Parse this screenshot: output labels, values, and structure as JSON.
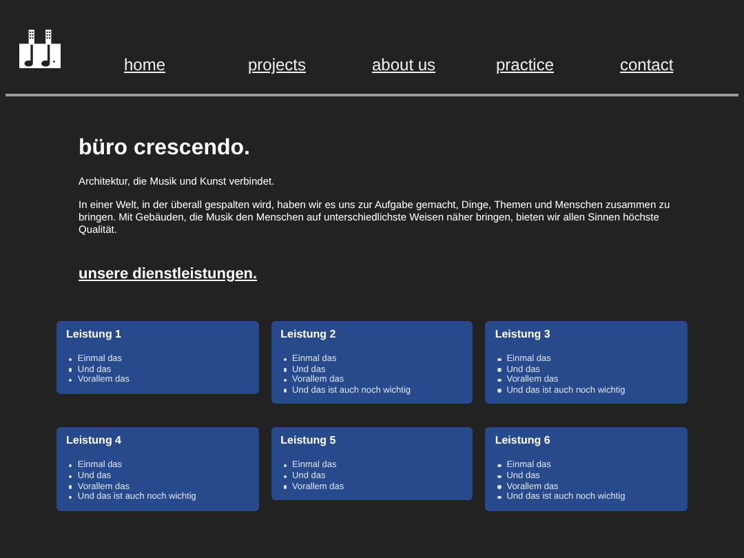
{
  "nav": [
    {
      "label": "home"
    },
    {
      "label": "projects"
    },
    {
      "label": "about us"
    },
    {
      "label": "practice"
    },
    {
      "label": "contact"
    }
  ],
  "heading": "büro crescendo.",
  "tagline": "Architektur, die Musik und Kunst verbindet.",
  "intro": "In einer Welt, in der überall gespalten wird, haben wir es uns zur Aufgabe gemacht, Dinge, Themen und Menschen zusammen zu bringen. Mit Gebäuden, die Musik den Menschen auf unterschiedlichste Weisen näher bringen, bieten wir allen Sinnen höchste Qualität.",
  "services_heading": "unsere dienstleistungen.",
  "services": [
    {
      "title": "Leistung 1",
      "items": [
        "Einmal das",
        "Und das",
        "Vorallem das"
      ]
    },
    {
      "title": "Leistung 2",
      "items": [
        "Einmal das",
        "Und das",
        "Vorallem das",
        "Und das ist auch noch wichtig"
      ]
    },
    {
      "title": "Leistung 3",
      "items": [
        "Einmal das",
        "Und das",
        "Vorallem das",
        "Und das ist auch noch wichtig"
      ]
    },
    {
      "title": "Leistung 4",
      "items": [
        "Einmal das",
        "Und das",
        "Vorallem das",
        "Und das ist auch noch wichtig"
      ]
    },
    {
      "title": "Leistung 5",
      "items": [
        "Einmal das",
        "Und das",
        "Vorallem das"
      ]
    },
    {
      "title": "Leistung 6",
      "items": [
        "Einmal das",
        "Und das",
        "Vorallem das",
        "Und das ist auch noch wichtig"
      ]
    }
  ]
}
